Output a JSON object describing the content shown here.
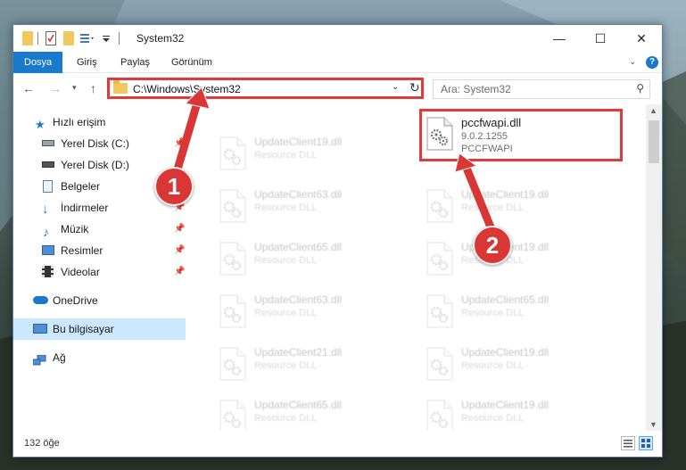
{
  "window": {
    "title": "System32",
    "controls": {
      "minimize": "—",
      "maximize": "☐",
      "close": "✕"
    }
  },
  "ribbon": {
    "tabs": [
      "Dosya",
      "Giriş",
      "Paylaş",
      "Görünüm"
    ],
    "help": "?"
  },
  "address": {
    "path": "C:\\Windows\\System32",
    "search_placeholder": "Ara: System32"
  },
  "navigation": {
    "items": [
      {
        "label": "Hızlı erişim",
        "icon": "star-icon",
        "pinned": false
      },
      {
        "label": "Yerel Disk (C:)",
        "icon": "drive-icon",
        "pinned": true
      },
      {
        "label": "Yerel Disk (D:)",
        "icon": "drive-icon",
        "pinned": false
      },
      {
        "label": "Belgeler",
        "icon": "documents-icon",
        "pinned": true
      },
      {
        "label": "İndirmeler",
        "icon": "download-icon",
        "pinned": true
      },
      {
        "label": "Müzik",
        "icon": "music-icon",
        "pinned": true
      },
      {
        "label": "Resimler",
        "icon": "pictures-icon",
        "pinned": true
      },
      {
        "label": "Videolar",
        "icon": "video-icon",
        "pinned": true
      },
      {
        "label": "OneDrive",
        "icon": "cloud-icon",
        "pinned": false
      },
      {
        "label": "Bu bilgisayar",
        "icon": "computer-icon",
        "pinned": false,
        "selected": true
      },
      {
        "label": "Ağ",
        "icon": "network-icon",
        "pinned": false
      }
    ]
  },
  "files": {
    "left_column": [
      {
        "name": "UpdateClient19.dll",
        "desc": "Resource DLL"
      },
      {
        "name": "UpdateClient63.dll",
        "desc": "Resource DLL"
      },
      {
        "name": "UpdateClient65.dll",
        "desc": "Resource DLL"
      },
      {
        "name": "UpdateClient63.dll",
        "desc": "Resource DLL"
      },
      {
        "name": "UpdateClient21.dll",
        "desc": "Resource DLL"
      },
      {
        "name": "UpdateClient65.dll",
        "desc": "Resource DLL"
      }
    ],
    "right_column": [
      {
        "name": "UpdateClient19.dll",
        "desc": "Resource DLL"
      },
      {
        "name": "UpdateClient19.dll",
        "desc": "Resource DLL"
      },
      {
        "name": "UpdateClient65.dll",
        "desc": "Resource DLL"
      },
      {
        "name": "UpdateClient19.dll",
        "desc": "Resource DLL"
      },
      {
        "name": "UpdateClient19.dll",
        "desc": "Resource DLL"
      }
    ],
    "highlighted": {
      "name": "pccfwapi.dll",
      "version": "9.0.2.1255",
      "company": "PCCFWAPI"
    }
  },
  "status": {
    "count": "132 öğe"
  },
  "annotations": {
    "step1": "1",
    "step2": "2",
    "accent": "#d93636"
  }
}
